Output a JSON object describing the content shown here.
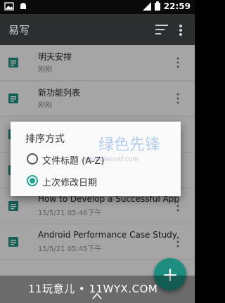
{
  "status_bar": {
    "time": "22:59",
    "battery": "3"
  },
  "app_bar": {
    "title": "易写"
  },
  "notes": [
    {
      "title": "明天安排",
      "time": "刚刚"
    },
    {
      "title": "新功能列表",
      "time": "刚刚"
    },
    {
      "title": "",
      "time": ""
    },
    {
      "title": "",
      "time": ""
    },
    {
      "title": "How to Develop a Successful App",
      "time": "15/5/21 05:46下午"
    },
    {
      "title": "Android Performance Case Study",
      "time": "15/5/21 05:45下午"
    }
  ],
  "sort_dialog": {
    "title": "排序方式",
    "options": [
      {
        "label": "文件标题 (A-Z)",
        "checked": false
      },
      {
        "label": "上次修改日期",
        "checked": true
      }
    ]
  },
  "watermark": {
    "logo": "绿色先锋",
    "url": "www.greenxf.com"
  },
  "fab": {
    "label": "+"
  },
  "footer_banner": {
    "text": "11玩意儿 • 11WYX.COM"
  },
  "colors": {
    "accent": "#20a291",
    "app_bar": "#2b2f2f",
    "note_icon": "#1e8e80"
  }
}
